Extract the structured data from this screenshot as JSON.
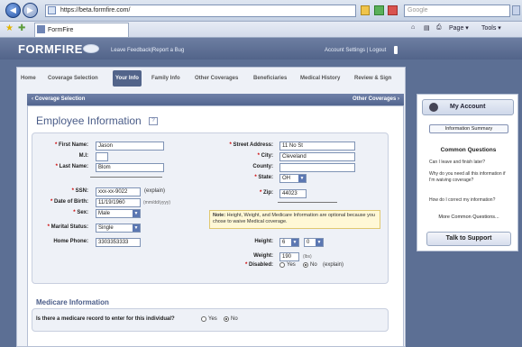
{
  "browser": {
    "url": "https://beta.formfire.com/",
    "search_placeholder": "Google",
    "tab_title": "FormFire",
    "page_menu": "Page ▾",
    "tools_menu": "Tools ▾"
  },
  "header": {
    "logo": "FORMFIRE",
    "feedback": "Leave Feedback|Report a Bug",
    "account": "Account Settings | Logout"
  },
  "tabs": [
    "Home",
    "Coverage Selection",
    "Your Info",
    "Family Info",
    "Other Coverages",
    "Beneficiaries",
    "Medical History",
    "Review & Sign"
  ],
  "nav": {
    "prev": "‹ Coverage Selection",
    "next": "Other Coverages ›"
  },
  "form": {
    "title": "Employee Information",
    "first_name_label": "First Name:",
    "first_name": "Jason",
    "mi_label": "M.I:",
    "mi": "",
    "last_name_label": "Last Name:",
    "last_name": "Blom",
    "ssn_label": "SSN:",
    "ssn": "xxx-xx-9022",
    "explain": "(explain)",
    "dob_label": "Date of Birth:",
    "dob": "11/19/1960",
    "dob_hint": "(mm/dd/yyyy)",
    "sex_label": "Sex:",
    "sex": "Male",
    "marital_label": "Marital Status:",
    "marital": "Single",
    "phone_label": "Home Phone:",
    "phone": "3303353333",
    "street_label": "Street Address:",
    "street": "11 No St",
    "city_label": "City:",
    "city": "Cleveland",
    "county_label": "County:",
    "county": "",
    "state_label": "State:",
    "state": "OH",
    "zip_label": "Zip:",
    "zip": "44023",
    "note_bold": "Note:",
    "note": " Height, Weight, and Medicare Information are optional because you chose to waive Medical coverage.",
    "height_label": "Height:",
    "height_ft": "6",
    "height_in": "0",
    "weight_label": "Weight:",
    "weight": "190",
    "weight_unit": "(lbs)",
    "disabled_label": "Disabled:",
    "yes": "Yes",
    "no": "No",
    "disabled_explain": "(explain)"
  },
  "medicare": {
    "title": "Medicare Information",
    "question": "Is there a medicare record to enter for this individual?",
    "yes": "Yes",
    "no": "No"
  },
  "sidebar": {
    "my_account": "My Account",
    "info_summary": "Information Summary",
    "common_questions": "Common Questions",
    "faq1": "Can I leave and finish later?",
    "faq2": "Why do you need all this information if I'm waiving coverage?",
    "faq3": "How do I correct my information?",
    "more": "More Common Questions...",
    "talk": "Talk to Support"
  },
  "colors": {
    "header": "#52648a",
    "required": "#cc0000",
    "note_bg": "#fff8d6"
  }
}
